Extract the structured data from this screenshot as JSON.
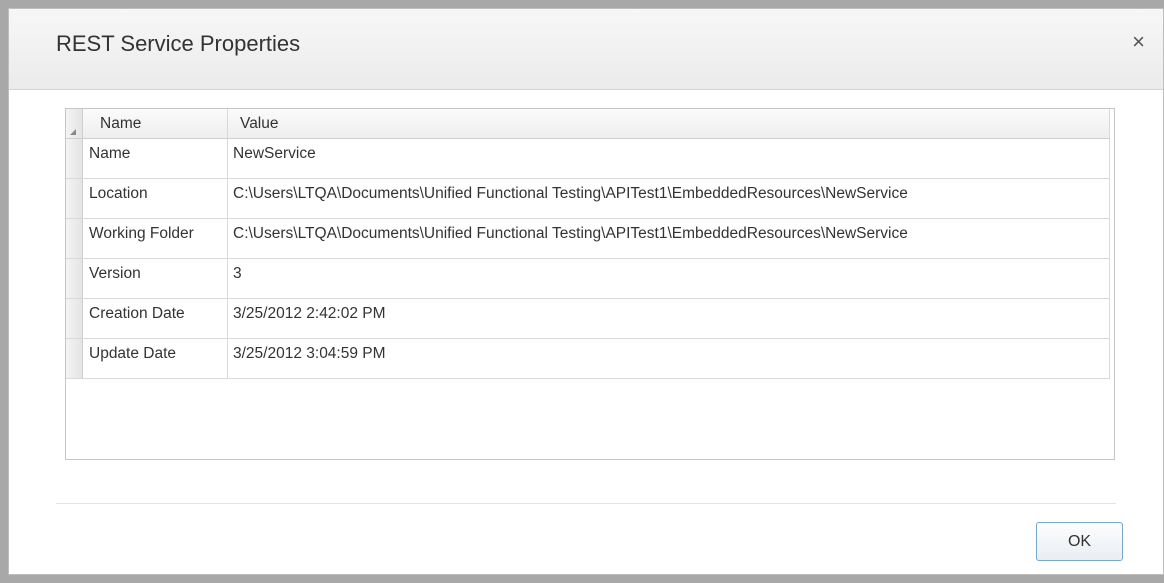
{
  "dialog": {
    "title": "REST Service Properties",
    "close_glyph": "×",
    "ok_label": "OK"
  },
  "grid": {
    "columns": [
      "Name",
      "Value"
    ],
    "rows": [
      {
        "name": "Name",
        "value": "NewService"
      },
      {
        "name": "Location",
        "value": "C:\\Users\\LTQA\\Documents\\Unified Functional Testing\\APITest1\\EmbeddedResources\\NewService"
      },
      {
        "name": "Working Folder",
        "value": "C:\\Users\\LTQA\\Documents\\Unified Functional Testing\\APITest1\\EmbeddedResources\\NewService"
      },
      {
        "name": "Version",
        "value": "3"
      },
      {
        "name": "Creation Date",
        "value": "3/25/2012 2:42:02 PM"
      },
      {
        "name": "Update Date",
        "value": "3/25/2012 3:04:59 PM"
      }
    ]
  },
  "colors": {
    "ok_border": "#7aa6c8",
    "background": "#a8a8a8"
  }
}
